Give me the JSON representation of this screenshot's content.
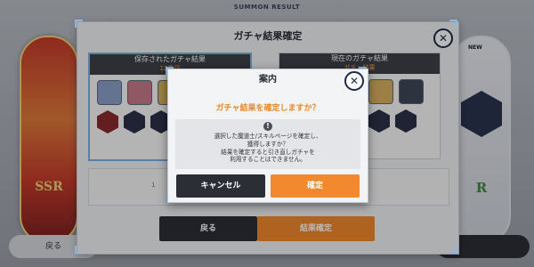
{
  "scene": {
    "title": "SUMMON RESULT",
    "left_card_rank": "SSR",
    "right_card_rank": "R",
    "right_card_badge": "NEW",
    "back_button": "戻る"
  },
  "main_dialog": {
    "title": "ガチャ結果確定",
    "close_icon": "close-icon",
    "saved_panel": {
      "title": "保存されたガチャ結果",
      "subtitle": "12番目"
    },
    "current_panel": {
      "title": "現在のガチャ結果",
      "subtitle": "ガチャ結果"
    },
    "summary_prefix": "1",
    "back_label": "戻る",
    "confirm_label": "結果確定"
  },
  "popup": {
    "title": "案内",
    "close_icon": "close-icon",
    "question": "ガチャ結果を確定しますか？",
    "info_icon": "!",
    "notice_lines": [
      "選択した魔道士/スキルページを確定し、",
      "獲得しますか？",
      "結果を確定すると引き直しガチャを",
      "利用することはできません。"
    ],
    "cancel_label": "キャンセル",
    "confirm_label": "確定"
  },
  "colors": {
    "accent_orange": "#f2892e",
    "dark_button": "#2b2e35",
    "navy_icon": "#1e2a4a"
  }
}
